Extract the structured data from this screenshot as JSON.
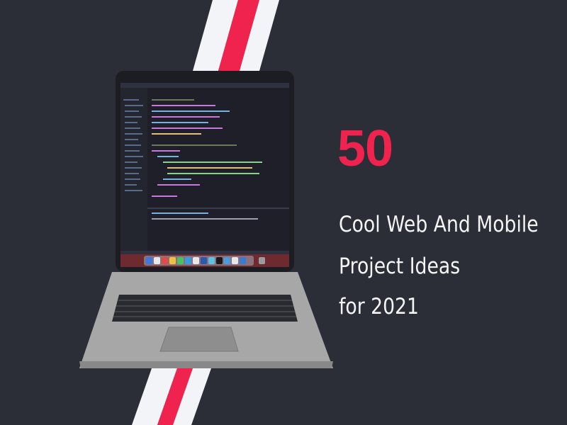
{
  "headline": {
    "number": "50",
    "lines": [
      "Cool Web And Mobile",
      "Project Ideas",
      "for 2021"
    ]
  },
  "colors": {
    "background": "#2b2e36",
    "accent": "#f0224e",
    "stripe_light": "#f3f4f8",
    "text": "#f4f4f4",
    "laptop_body": "#a7a7a7",
    "laptop_bezel": "#1c1d22",
    "editor_bg": "#1e1f29"
  },
  "icons": {
    "laptop": "laptop-icon",
    "dock": "app-dock-icons"
  }
}
